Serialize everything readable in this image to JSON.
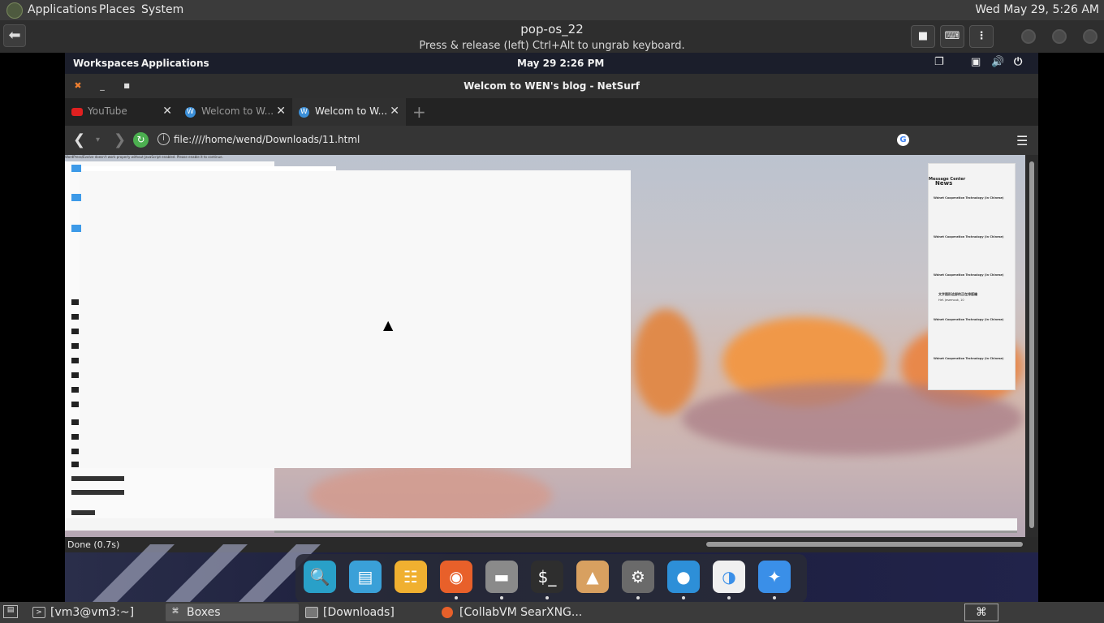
{
  "host_panel": {
    "menus": [
      "Applications",
      "Places",
      "System"
    ],
    "clock": "Wed May 29,  5:26 AM"
  },
  "boxes": {
    "vm_title": "pop-os_22",
    "subtitle": "Press & release (left) Ctrl+Alt to ungrab keyboard."
  },
  "guest_panel": {
    "workspaces": "Workspaces",
    "applications": "Applications",
    "clock": "May 29   2:26 PM"
  },
  "netsurf": {
    "title": "Welcom to WEN's blog - NetSurf",
    "tabs": [
      {
        "label": "YouTube",
        "icon": "youtube-icon"
      },
      {
        "label": "Welcom to W...",
        "icon": "w-icon"
      },
      {
        "label": "Welcom to W...",
        "icon": "w-icon"
      }
    ],
    "url": "file:////home/wend/Downloads/11.html",
    "status": "Done (0.7s)",
    "page": {
      "warning": "WordPress/Evolve doesn't work properly without JavaScript enabled. Please enable it to continue.",
      "sidebar_title_1": "Message Center",
      "sidebar_title_2": "News",
      "sidebar_item": "Wdnet Cooperation Technology (in Chinese)",
      "sidebar_chinese": "文字图形这部的正在排版编",
      "sidebar_chinese_sub": "Hef. Jesemouk, 10"
    }
  },
  "dock": {
    "apps": [
      {
        "name": "search-app",
        "icon": "magnifier-icon",
        "color": "#29a0c8"
      },
      {
        "name": "files-app",
        "icon": "window-icon",
        "color": "#3aa0d8"
      },
      {
        "name": "app-grid",
        "icon": "grid-icon",
        "color": "#f0b030"
      },
      {
        "name": "firefox",
        "icon": "firefox-icon",
        "color": "#e8602a"
      },
      {
        "name": "file-manager",
        "icon": "folder-icon",
        "color": "#8a8a8a"
      },
      {
        "name": "terminal",
        "icon": "terminal-icon",
        "color": "#2e2e2e"
      },
      {
        "name": "pop-shop",
        "icon": "rocket-icon",
        "color": "#d8a060"
      },
      {
        "name": "settings",
        "icon": "gear-icon",
        "color": "#6a6a6a"
      },
      {
        "name": "browser",
        "icon": "globe-icon",
        "color": "#2d8fd8"
      },
      {
        "name": "toggle-app",
        "icon": "toggle-icon",
        "color": "#f0f0f0"
      },
      {
        "name": "extensions",
        "icon": "puzzle-icon",
        "color": "#3a8fe8"
      }
    ]
  },
  "taskbar": {
    "tasks": [
      "[vm3@vm3:~]",
      "Boxes",
      "[Downloads]",
      "[CollabVM SearXNG..."
    ]
  }
}
